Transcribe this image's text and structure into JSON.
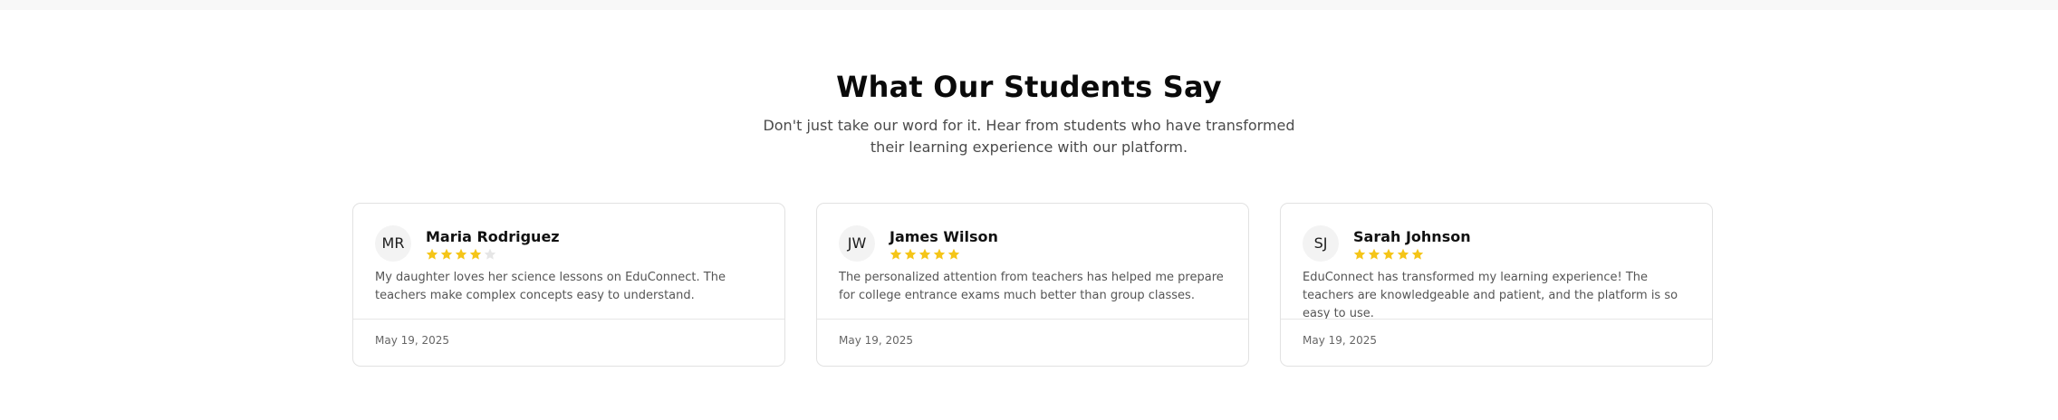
{
  "section": {
    "title": "What Our Students Say",
    "subtitle": "Don't just take our word for it. Hear from students who have transformed their learning experience with our platform."
  },
  "colors": {
    "star_filled": "#f5c518",
    "star_empty": "#e6e6e6"
  },
  "reviews": [
    {
      "initials": "MR",
      "name": "Maria Rodriguez",
      "rating": 4,
      "max_rating": 5,
      "text": "My daughter loves her science lessons on EduConnect. The teachers make complex concepts easy to understand.",
      "date": "May 19, 2025"
    },
    {
      "initials": "JW",
      "name": "James Wilson",
      "rating": 5,
      "max_rating": 5,
      "text": "The personalized attention from teachers has helped me prepare for college entrance exams much better than group classes.",
      "date": "May 19, 2025"
    },
    {
      "initials": "SJ",
      "name": "Sarah Johnson",
      "rating": 5,
      "max_rating": 5,
      "text": "EduConnect has transformed my learning experience! The teachers are knowledgeable and patient, and the platform is so easy to use.",
      "date": "May 19, 2025"
    }
  ]
}
